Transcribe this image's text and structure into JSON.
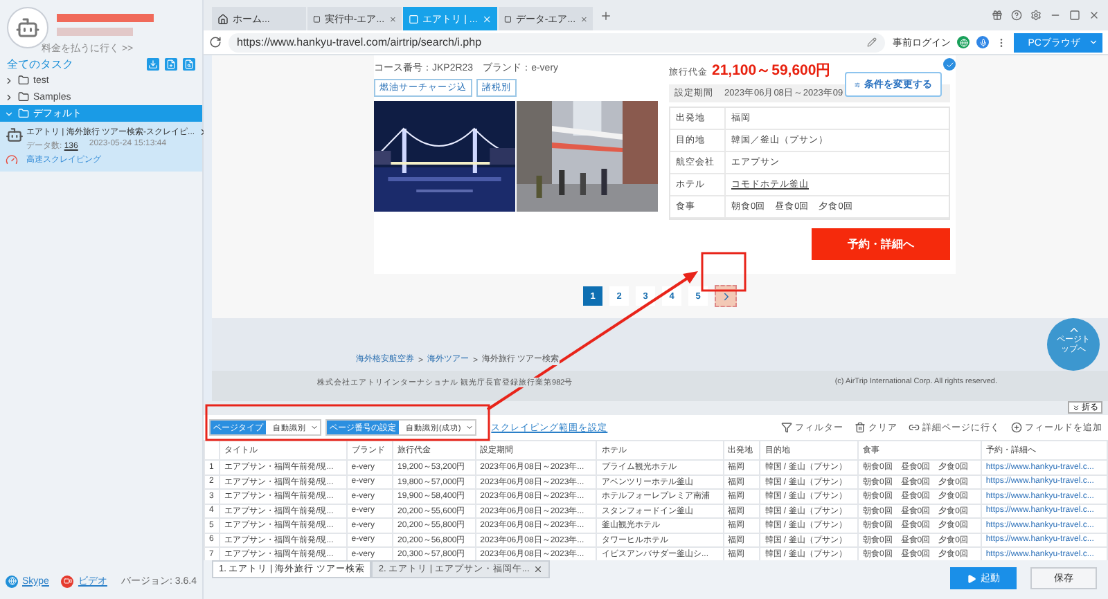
{
  "sidebar": {
    "account_link": "料金を払うに行く >>",
    "heading": "全てのタスク",
    "folders": [
      {
        "name": "test",
        "expanded": false,
        "selected": false
      },
      {
        "name": "Samples",
        "expanded": false,
        "selected": false
      },
      {
        "name": "デフォルト",
        "expanded": true,
        "selected": true,
        "tasks": [
          {
            "title": "エアトリ | 海外旅行 ツアー検索-スクレイピ...",
            "count_label": "データ数:",
            "count": "136",
            "timestamp": "2023-05-24 15:13:44",
            "mode": "高速スクレイピング"
          }
        ]
      }
    ],
    "links": [
      {
        "label": "Skype",
        "kind": "skype"
      },
      {
        "label": "ビデオ",
        "kind": "video"
      }
    ],
    "version": "バージョン: 3.6.4"
  },
  "browser": {
    "tabs": [
      {
        "label": "ホーム...",
        "kind": "home",
        "selected": false
      },
      {
        "label": "実行中-エア...",
        "kind": "page",
        "selected": false
      },
      {
        "label": "エアトリ | ...",
        "kind": "page",
        "selected": true
      },
      {
        "label": "データ-エア...",
        "kind": "page",
        "selected": false
      }
    ],
    "url": "https://www.hankyu-travel.com/airtrip/search/i.php",
    "login": "事前ログイン",
    "mode_button": "PCブラウザ"
  },
  "page": {
    "course": "コース番号：JKP2R23　ブランド：e-very",
    "tags": [
      "燃油サーチャージ込",
      "諸税別"
    ],
    "price_label": "旅行代金",
    "price": "21,100～59,600円",
    "period_label": "設定期間",
    "period": "2023年06月08日～2023年09",
    "change_button": "条件を変更する",
    "details": [
      {
        "label": "出発地",
        "value": "福岡",
        "kind": "text"
      },
      {
        "label": "目的地",
        "value": "韓国／釜山（プサン）",
        "kind": "text"
      },
      {
        "label": "航空会社",
        "value": "エアプサン",
        "kind": "text"
      },
      {
        "label": "ホテル",
        "value": "コモドホテル釜山",
        "kind": "link"
      },
      {
        "label": "食事",
        "value": "朝食0回　昼食0回　夕食0回",
        "kind": "text"
      }
    ],
    "book_button": "予約・詳細へ",
    "pages": [
      {
        "label": "1",
        "selected": true
      },
      {
        "label": "2",
        "selected": false
      },
      {
        "label": "3",
        "selected": false
      },
      {
        "label": "4",
        "selected": false
      },
      {
        "label": "5",
        "selected": false
      }
    ],
    "breadcrumbs": {
      "separator": ">",
      "items": [
        {
          "label": "海外格安航空券",
          "kind": "link"
        },
        {
          "label": "海外ツアー",
          "kind": "link"
        },
        {
          "label": "海外旅行 ツアー検索",
          "kind": "text"
        }
      ]
    },
    "company": "株式会社エアトリインターナショナル 観光庁長官登録旅行業第982号",
    "copyright": "(c) AirTrip International Corp. All rights reserved.",
    "page_top": "ページトップへ"
  },
  "extraction": {
    "collapse": "折る",
    "selectors": [
      {
        "label": "ページタイプ",
        "value": "自動識別"
      },
      {
        "label": "ページ番号の設定",
        "value": "自動識別(成功)"
      }
    ],
    "range_link": "スクレイピング範囲を設定",
    "actions": [
      {
        "label": "フィルター",
        "kind": "filter"
      },
      {
        "label": "クリア",
        "kind": "clear"
      },
      {
        "label": "詳細ページに行く",
        "kind": "link"
      },
      {
        "label": "フィールドを追加",
        "kind": "add"
      }
    ],
    "table": {
      "columns": [
        "タイトル",
        "ブランド",
        "旅行代金",
        "設定期間",
        "ホテル",
        "出発地",
        "目的地",
        "食事",
        "予約・詳細へ"
      ],
      "rows": [
        {
          "index": "1",
          "cells": [
            "エアプサン・福岡午前発/現...",
            "e-very",
            "19,200～53,200円",
            "2023年06月08日～2023年...",
            "プライム観光ホテル",
            "福岡",
            "韓国 / 釜山（プサン）",
            "朝食0回　昼食0回　夕食0回",
            "https://www.hankyu-travel.c..."
          ]
        },
        {
          "index": "2",
          "cells": [
            "エアプサン・福岡午前発/現...",
            "e-very",
            "19,800～57,000円",
            "2023年06月08日～2023年...",
            "アベンツリーホテル釜山",
            "福岡",
            "韓国 / 釜山（プサン）",
            "朝食0回　昼食0回　夕食0回",
            "https://www.hankyu-travel.c..."
          ]
        },
        {
          "index": "3",
          "cells": [
            "エアプサン・福岡午前発/現...",
            "e-very",
            "19,900～58,400円",
            "2023年06月08日～2023年...",
            "ホテルフォーレプレミア南浦",
            "福岡",
            "韓国 / 釜山（プサン）",
            "朝食0回　昼食0回　夕食0回",
            "https://www.hankyu-travel.c..."
          ]
        },
        {
          "index": "4",
          "cells": [
            "エアプサン・福岡午前発/現...",
            "e-very",
            "20,200～55,600円",
            "2023年06月08日～2023年...",
            "スタンフォードイン釜山",
            "福岡",
            "韓国 / 釜山（プサン）",
            "朝食0回　昼食0回　夕食0回",
            "https://www.hankyu-travel.c..."
          ]
        },
        {
          "index": "5",
          "cells": [
            "エアプサン・福岡午前発/現...",
            "e-very",
            "20,200～55,800円",
            "2023年06月08日～2023年...",
            "釜山観光ホテル",
            "福岡",
            "韓国 / 釜山（プサン）",
            "朝食0回　昼食0回　夕食0回",
            "https://www.hankyu-travel.c..."
          ]
        },
        {
          "index": "6",
          "cells": [
            "エアプサン・福岡午前発/現...",
            "e-very",
            "20,200～56,800円",
            "2023年06月08日～2023年...",
            "タワーヒルホテル",
            "福岡",
            "韓国 / 釜山（プサン）",
            "朝食0回　昼食0回　夕食0回",
            "https://www.hankyu-travel.c..."
          ]
        },
        {
          "index": "7",
          "cells": [
            "エアプサン・福岡午前発/現...",
            "e-very",
            "20,300～57,800円",
            "2023年06月08日～2023年...",
            "イビスアンバサダー釜山シ...",
            "福岡",
            "韓国 / 釜山（プサン）",
            "朝食0回　昼食0回　夕食0回",
            "https://www.hankyu-travel.c..."
          ]
        }
      ]
    },
    "task_tabs": [
      {
        "label": "1. エアトリ | 海外旅行 ツアー検索",
        "selected": true,
        "closable": false
      },
      {
        "label": "2. エアトリ | エアプサン・福岡午...",
        "selected": false,
        "closable": true
      }
    ],
    "start": "起動",
    "save": "保存"
  }
}
